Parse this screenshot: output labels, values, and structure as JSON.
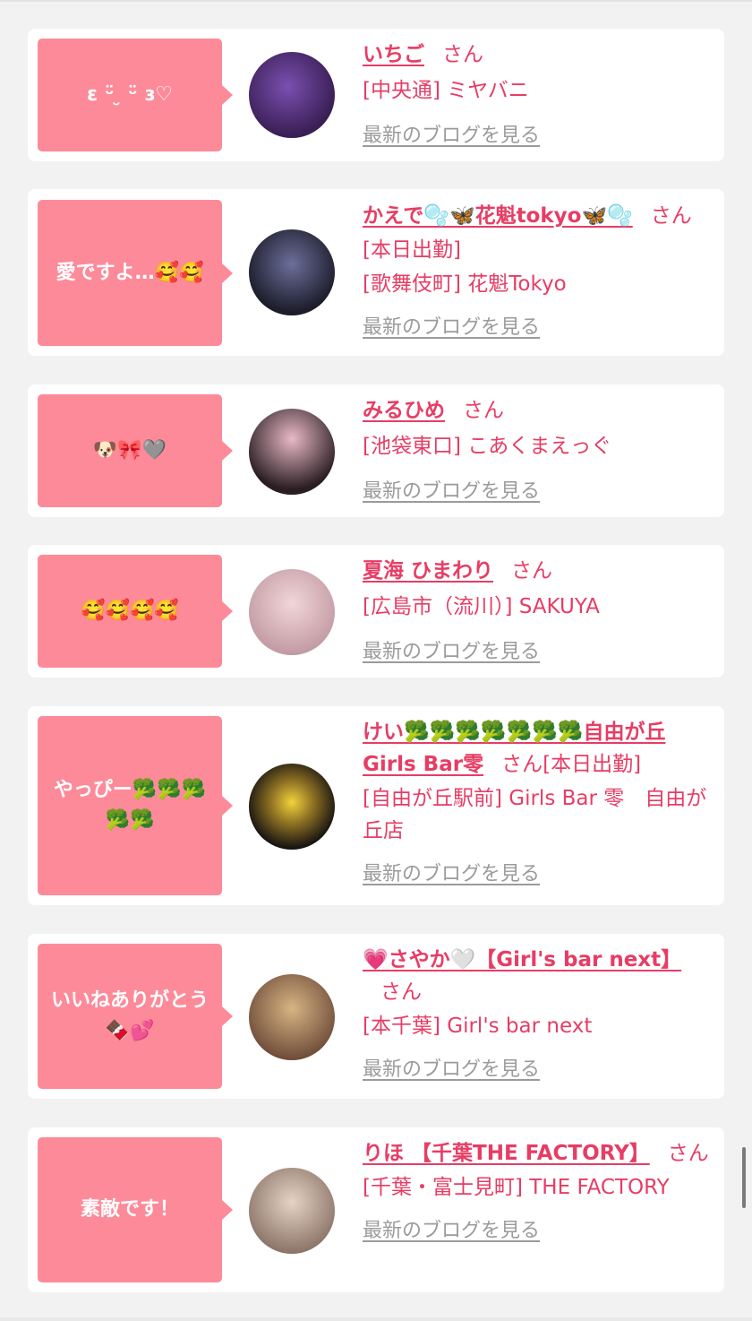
{
  "cards": [
    {
      "bubble": "ɛ ᵕ̈ ̮ ᵕ̈ ɜ♡",
      "name": "いちご",
      "san": "さん",
      "line1": "[中央通] ミヤバニ",
      "blog": "最新のブログを見る",
      "avatar_colors": [
        "#3a1f55",
        "#7b4fb0"
      ]
    },
    {
      "bubble": "愛ですよ…🥰🥰",
      "name": "かえで🫧🦋花魁tokyo🦋🫧",
      "san": "さん",
      "line1": "[本日出勤]",
      "line2": "[歌舞伎町] 花魁Tokyo",
      "blog": "最新のブログを見る",
      "avatar_colors": [
        "#1c1c2a",
        "#6c6f9a"
      ]
    },
    {
      "bubble": "🐶🎀🩶",
      "name": "みるひめ",
      "san": "さん",
      "line1": "[池袋東口] こあくまえっぐ",
      "blog": "最新のブログを見る",
      "avatar_colors": [
        "#2a1e22",
        "#e9b9c7"
      ]
    },
    {
      "bubble": "🥰🥰🥰🥰",
      "name": "夏海 ひまわり",
      "san": "さん",
      "line1": "[広島市（流川）] SAKUYA",
      "blog": "最新のブログを見る",
      "avatar_colors": [
        "#f1d6d9",
        "#c29aa3"
      ]
    },
    {
      "bubble": "やっぴー🥦🥦🥦🥦🥦",
      "name": "けい🥦🥦🥦🥦🥦🥦🥦自由が丘Girls Bar零",
      "san": "さん",
      "after_san": "[本日出勤]",
      "line1": "[自由が丘駅前] Girls Bar 零　自由が丘店",
      "blog": "最新のブログを見る",
      "avatar_colors": [
        "#161412",
        "#f1d23c"
      ]
    },
    {
      "bubble": "いいねありがとう🍫💕",
      "name": "💗さやか🤍【Girl's bar next】",
      "san": "さん",
      "line1": "[本千葉] Girl's bar next",
      "blog": "最新のブログを見る",
      "avatar_colors": [
        "#d8b483",
        "#6f4d3a"
      ]
    },
    {
      "bubble": "素敵です！",
      "name": "りほ 【千葉THE FACTORY】",
      "san": "さん",
      "line1": "[千葉・富士見町] THE FACTORY",
      "blog": "最新のブログを見る",
      "avatar_colors": [
        "#e7d2c7",
        "#8b7568"
      ]
    }
  ]
}
